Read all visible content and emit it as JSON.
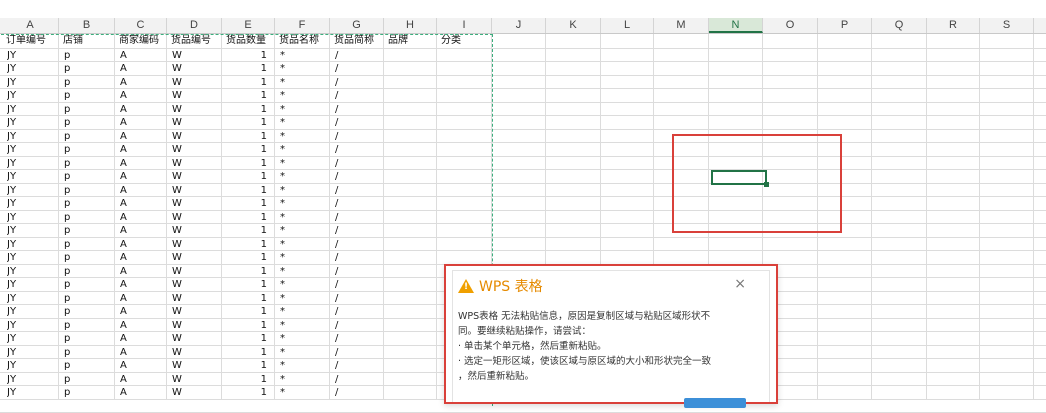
{
  "columns": [
    "A",
    "B",
    "C",
    "D",
    "E",
    "F",
    "G",
    "H",
    "I",
    "J",
    "K",
    "L",
    "M",
    "N",
    "O",
    "P",
    "Q",
    "R",
    "S"
  ],
  "selected_column": "N",
  "headers": [
    "订单编号",
    "店铺",
    "商家编码",
    "货品编号",
    "货品数量",
    "货品名称",
    "货品简称",
    "品牌",
    "分类"
  ],
  "row_values": {
    "a": "JY",
    "b": "p",
    "c": "A",
    "d": "W",
    "e": "1",
    "f": "*",
    "g": "/"
  },
  "dialog": {
    "title": "WPS 表格",
    "close": "×",
    "line1": "WPS表格 无法粘贴信息，原因是复制区域与粘贴区域形状不",
    "line2": "同。要继续粘贴操作，请尝试：",
    "line3": "· 单击某个单元格，然后重新粘贴。",
    "line4": "· 选定一矩形区域，使该区域与原区域的大小和形状完全一致",
    "line5": "，然后重新粘贴。"
  },
  "colors": {
    "accent": "#217346",
    "annotation": "#d9403a",
    "warning": "#f0a000",
    "title": "#e58a00"
  }
}
